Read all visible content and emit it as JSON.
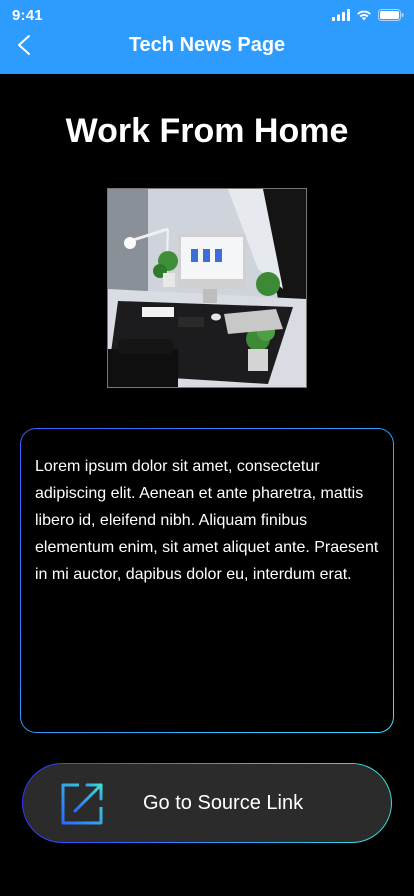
{
  "status_bar": {
    "time": "9:41"
  },
  "nav": {
    "title": "Tech News Page",
    "back_icon": "chevron-left-icon"
  },
  "article": {
    "headline": "Work From Home",
    "image_alt": "desk-workspace-photo",
    "body": "Lorem ipsum dolor sit amet, consectetur adipiscing elit. Aenean et ante pharetra, mattis libero id, eleifend nibh. Aliquam finibus elementum enim, sit amet aliquet ante. Praesent in mi auctor, dapibus dolor eu, interdum erat."
  },
  "source_link": {
    "label": "Go to Source Link",
    "icon": "external-link-icon"
  },
  "colors": {
    "header_bg": "#2e9bff",
    "page_bg": "#000000",
    "button_bg": "#2b2b2b",
    "gradient_start": "#3b5bff",
    "gradient_end": "#3de0ff"
  }
}
